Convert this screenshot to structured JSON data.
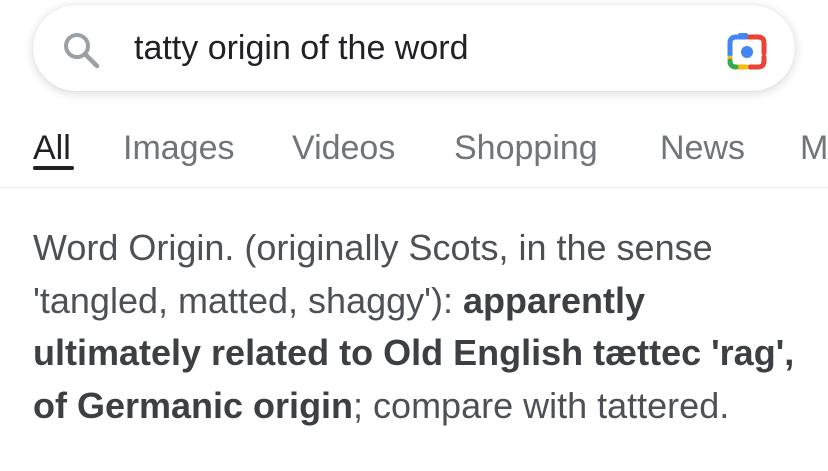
{
  "search": {
    "query": "tatty origin of the word",
    "icon": "search-icon",
    "lens_icon": "google-lens-camera-icon"
  },
  "tabs": [
    {
      "label": "All",
      "active": true
    },
    {
      "label": "Images",
      "active": false
    },
    {
      "label": "Videos",
      "active": false
    },
    {
      "label": "Shopping",
      "active": false
    },
    {
      "label": "News",
      "active": false
    },
    {
      "label": "M",
      "active": false
    }
  ],
  "snippet": {
    "part1": "Word Origin. (originally Scots, in the sense 'tangled, matted, shaggy'): ",
    "bold": "apparently ultimately related to Old English tættec 'rag', of Germanic origin",
    "part2": "; compare with tattered."
  },
  "colors": {
    "text_primary": "#202124",
    "text_secondary": "#70757a",
    "lens_blue": "#4285f4",
    "lens_red": "#ea4335",
    "lens_yellow": "#fbbc05",
    "lens_green": "#34a853"
  }
}
